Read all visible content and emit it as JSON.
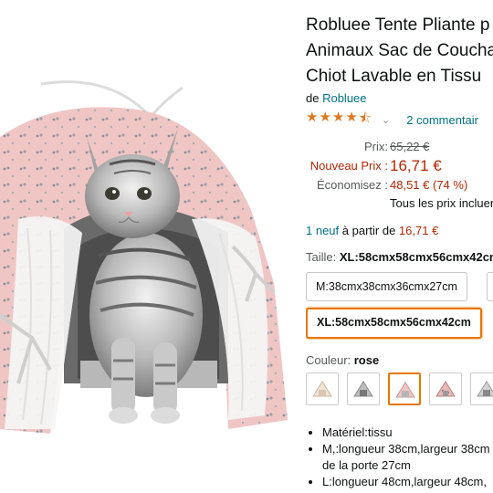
{
  "product": {
    "title_lines": [
      "Robluee Tente Pliante p",
      "Animaux Sac de Coucha",
      "Chiot Lavable en Tissu"
    ],
    "by_prefix": "de ",
    "brand": "Robluee",
    "rating": 4.5,
    "reviews_link": "2 commentair"
  },
  "pricing": {
    "prix_label": "Prix:",
    "prix_value": "65,22 €",
    "nouveau_label": "Nouveau Prix :",
    "nouveau_value": "16,71 €",
    "economise_label": "Économisez :",
    "economise_value": "48,51 € (74 %)",
    "tax_note": "Tous les prix incluen"
  },
  "offers": {
    "new_link": "1 neuf",
    "from_text": " à partir de ",
    "from_price": "16,71 €"
  },
  "size": {
    "label": "Taille: ",
    "selected": "XL:58cmx58cmx56cmx42cm",
    "options": [
      "M:38cmx38cmx36cmx27cm",
      "XL:58cmx58cmx56cmx42cm"
    ]
  },
  "color": {
    "label": "Couleur: ",
    "selected": "rose",
    "swatches": [
      "beige",
      "gray",
      "rose",
      "pink-pattern",
      "gray-pattern"
    ]
  },
  "features": [
    "Matériel:tissu",
    "M,:longueur 38cm,largeur 38cm",
    "de la porte 27cm",
    "L:longueur 48cm,largeur 48cm,"
  ],
  "colors": {
    "accent": "#e77600",
    "link": "#007185",
    "price": "#b12704",
    "star": "#de7921"
  }
}
